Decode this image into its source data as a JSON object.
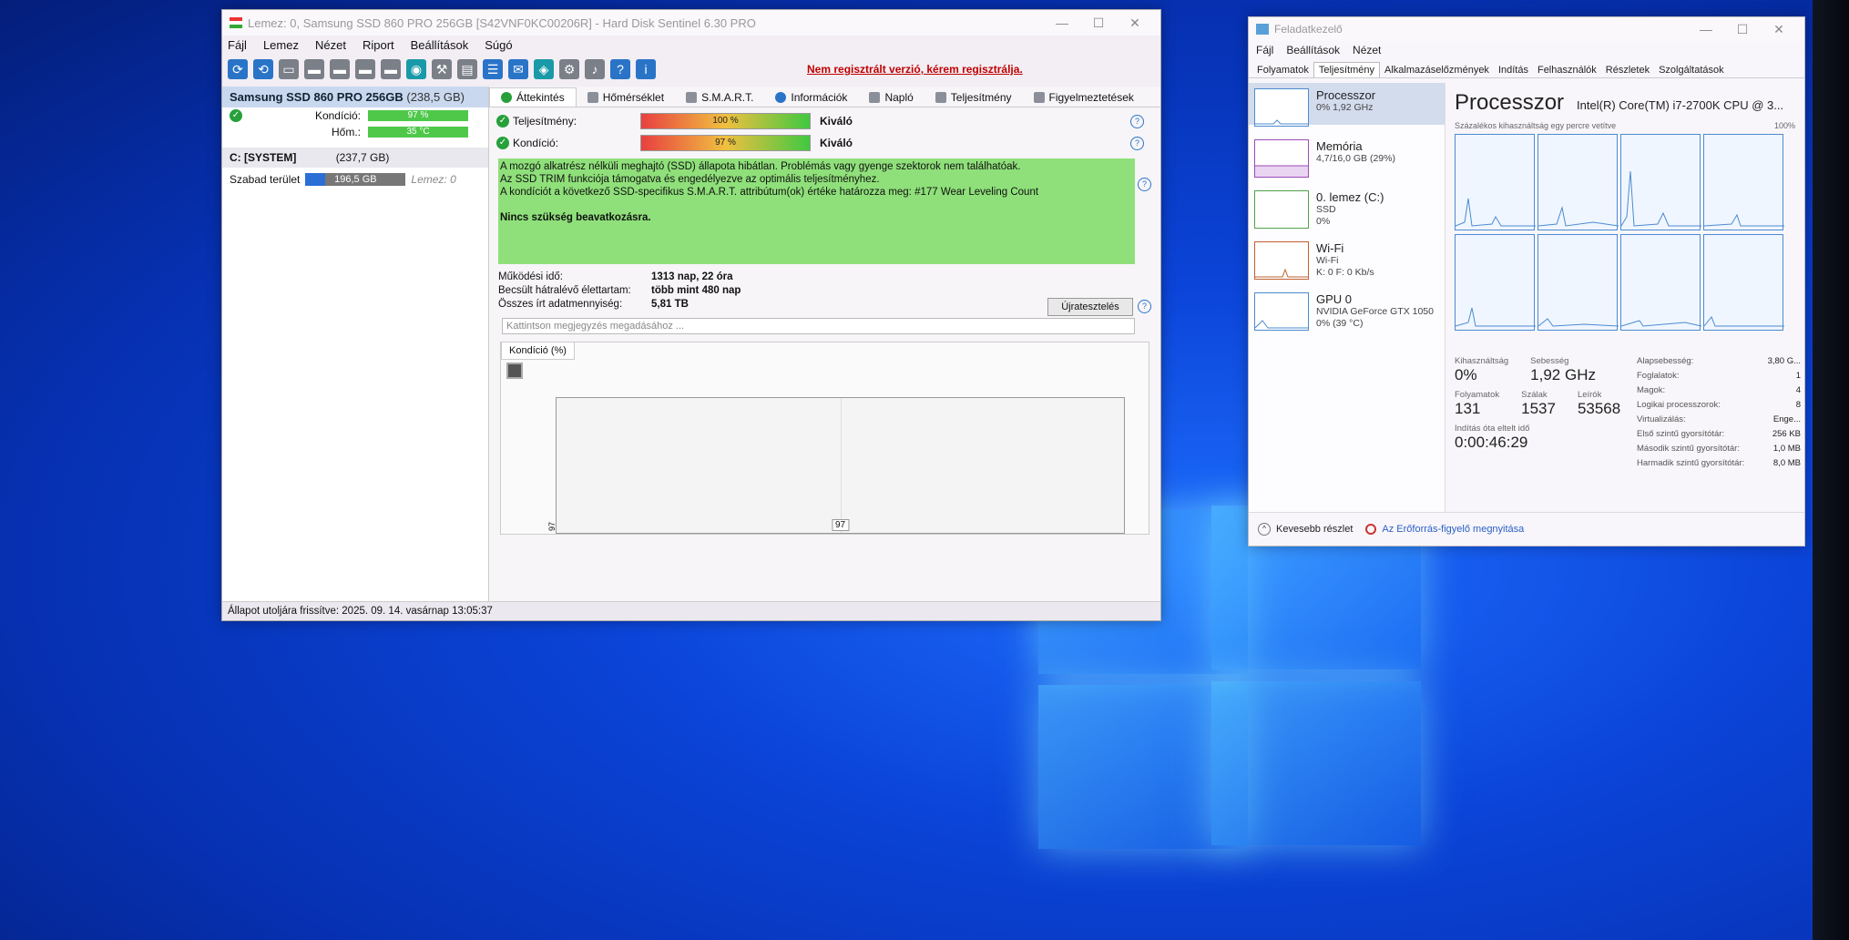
{
  "hds": {
    "title": "Lemez: 0, Samsung SSD 860 PRO 256GB [S42VNF0KC00206R]  -  Hard Disk Sentinel 6.30 PRO",
    "menu": [
      "Fájl",
      "Lemez",
      "Nézet",
      "Riport",
      "Beállítások",
      "Súgó"
    ],
    "reg_link": "Nem regisztrált verzió, kérem regisztrálja.",
    "left": {
      "disk_name": "Samsung SSD 860 PRO 256GB",
      "disk_cap": "(238,5 GB)",
      "rows": [
        {
          "label": "Kondíció:",
          "value": "97 %"
        },
        {
          "label": "Hőm.:",
          "value": "35 °C"
        }
      ],
      "volume": {
        "name": "C: [SYSTEM]",
        "size": "(237,7 GB)",
        "free_label": "Szabad terület",
        "free_value": "196,5 GB",
        "disk_ref": "Lemez: 0"
      }
    },
    "tabs": [
      "Áttekintés",
      "Hőmérséklet",
      "S.M.A.R.T.",
      "Információk",
      "Napló",
      "Teljesítmény",
      "Figyelmeztetések"
    ],
    "meters": [
      {
        "label": "Teljesítmény:",
        "bar": "100 %",
        "value": "Kiváló"
      },
      {
        "label": "Kondíció:",
        "bar": "97 %",
        "value": "Kiváló"
      }
    ],
    "info": {
      "line1": "A mozgó alkatrész nélküli meghajtó (SSD) állapota hibátlan. Problémás vagy gyenge szektorok nem találhatóak.",
      "line2": "Az SSD TRIM funkciója támogatva és engedélyezve az optimális teljesítményhez.",
      "line3": "A kondíciót a következő SSD-specifikus S.M.A.R.T. attribútum(ok) értéke határozza meg:  #177 Wear Leveling Count",
      "conclusion": "Nincs szükség beavatkozásra."
    },
    "stats": [
      {
        "k": "Működési idő:",
        "v": "1313 nap, 22 óra"
      },
      {
        "k": "Becsült hátralévő élettartam:",
        "v": "több mint 480 nap"
      },
      {
        "k": "Összes írt adatmennyiség:",
        "v": "5,81 TB"
      }
    ],
    "retest": "Újratesztelés",
    "note_placeholder": "Kattintson megjegyzés megadásához ...",
    "chart_tab": "Kondíció  (%)",
    "chart_data": {
      "type": "line",
      "ylabel": "97",
      "values": [
        97
      ],
      "data_label": "97"
    },
    "status": "Állapot utoljára frissítve: 2025. 09. 14. vasárnap 13:05:37"
  },
  "tm": {
    "title": "Feladatkezelő",
    "menu": [
      "Fájl",
      "Beállítások",
      "Nézet"
    ],
    "tabs": [
      "Folyamatok",
      "Teljesítmény",
      "Alkalmazáselőzmények",
      "Indítás",
      "Felhasználók",
      "Részletek",
      "Szolgáltatások"
    ],
    "side": [
      {
        "title": "Processzor",
        "sub1": "0% 1,92 GHz",
        "sub2": ""
      },
      {
        "title": "Memória",
        "sub1": "4,7/16,0 GB (29%)",
        "sub2": ""
      },
      {
        "title": "0. lemez (C:)",
        "sub1": "SSD",
        "sub2": "0%"
      },
      {
        "title": "Wi-Fi",
        "sub1": "Wi-Fi",
        "sub2": "K: 0 F: 0 Kb/s"
      },
      {
        "title": "GPU 0",
        "sub1": "NVIDIA GeForce GTX 1050",
        "sub2": "0% (39 °C)"
      }
    ],
    "cpu_title": "Processzor",
    "cpu_name": "Intel(R) Core(TM) i7-2700K CPU @ 3...",
    "graph_caption": "Százalékos kihasználtság egy percre vetítve",
    "graph_max": "100%",
    "metrics": {
      "kihasznaltsag_l": "Kihasználtság",
      "kihasznaltsag_v": "0%",
      "sebesseg_l": "Sebesség",
      "sebesseg_v": "1,92 GHz",
      "folyamatok_l": "Folyamatok",
      "folyamatok_v": "131",
      "szalak_l": "Szálak",
      "szalak_v": "1537",
      "leirok_l": "Leírók",
      "leirok_v": "53568",
      "uptime_l": "Indítás óta eltelt idő",
      "uptime_v": "0:00:46:29"
    },
    "props": [
      {
        "k": "Alapsebesség:",
        "v": "3,80 G..."
      },
      {
        "k": "Foglalatok:",
        "v": "1"
      },
      {
        "k": "Magok:",
        "v": "4"
      },
      {
        "k": "Logikai processzorok:",
        "v": "8"
      },
      {
        "k": "Virtualizálás:",
        "v": "Enge..."
      },
      {
        "k": "Első szintű gyorsítótár:",
        "v": "256 KB"
      },
      {
        "k": "Második szintű gyorsítótár:",
        "v": "1,0 MB"
      },
      {
        "k": "Harmadik szintű gyorsítótár:",
        "v": "8,0 MB"
      }
    ],
    "footer_less": "Kevesebb részlet",
    "footer_resmon": "Az Erőforrás-figyelő megnyitása"
  }
}
